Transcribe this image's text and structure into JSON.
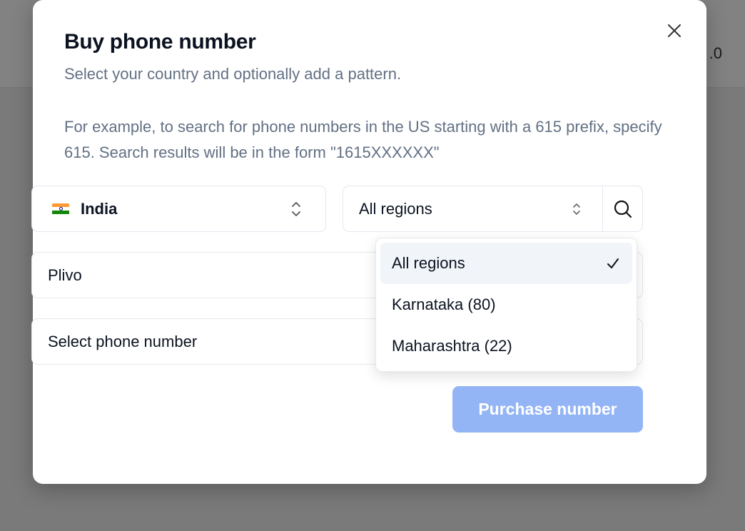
{
  "background": {
    "header_value": ".0"
  },
  "modal": {
    "title": "Buy phone number",
    "subtitle": "Select your country and optionally add a pattern.",
    "example_text": "For example, to search for phone numbers in the US starting with a 615 prefix, specify 615. Search results will be in the form \"1615XXXXXX\"",
    "close_icon": "close-icon"
  },
  "form": {
    "country": {
      "value": "India",
      "flag_icon": "india-flag-icon"
    },
    "region": {
      "value": "All regions"
    },
    "search_icon": "search-icon",
    "provider": {
      "value": "Plivo"
    },
    "phone_number": {
      "placeholder": "Select phone number"
    },
    "purchase_label": "Purchase number"
  },
  "dropdown": {
    "options": [
      {
        "label": "All regions",
        "selected": true
      },
      {
        "label": "Karnataka (80)",
        "selected": false
      },
      {
        "label": "Maharashtra (22)",
        "selected": false
      }
    ]
  },
  "colors": {
    "primary_disabled": "#93b4f5",
    "muted_text": "#627084",
    "title_text": "#0b1220",
    "overlay": "#7a7a7a"
  }
}
